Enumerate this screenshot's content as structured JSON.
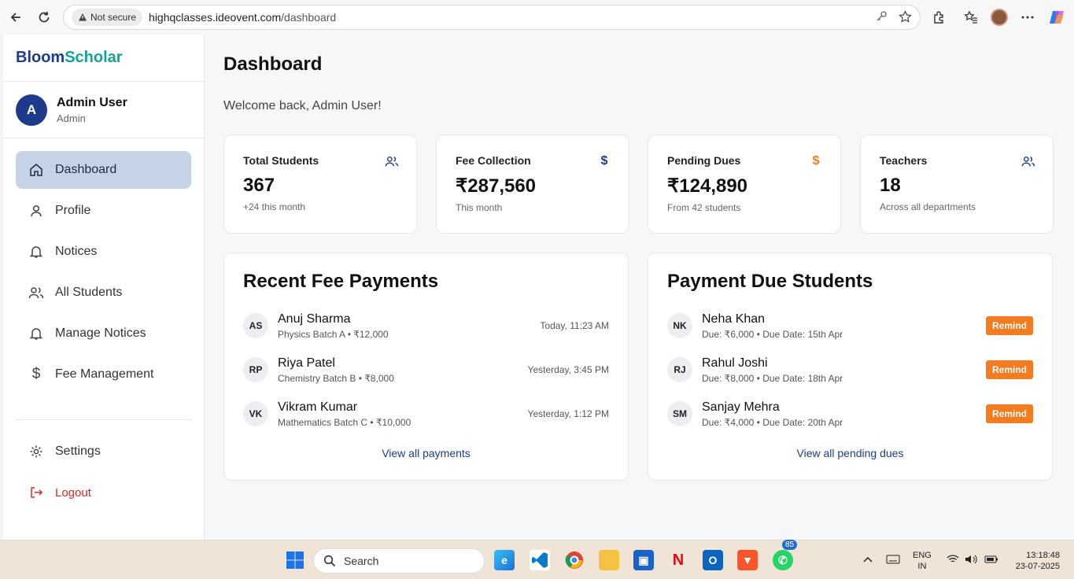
{
  "browser": {
    "security_label": "Not secure",
    "url_host": "highqclasses.ideovent.com",
    "url_path": "/dashboard"
  },
  "brand": {
    "part1": "Bloom",
    "part2": "Scholar",
    "color1": "#1e3a8a",
    "color2": "#14a39a"
  },
  "user": {
    "initial": "A",
    "name": "Admin User",
    "role": "Admin"
  },
  "nav": {
    "items": [
      {
        "label": "Dashboard",
        "icon": "home-icon",
        "active": true
      },
      {
        "label": "Profile",
        "icon": "user-icon"
      },
      {
        "label": "Notices",
        "icon": "bell-icon"
      },
      {
        "label": "All Students",
        "icon": "users-icon"
      },
      {
        "label": "Manage Notices",
        "icon": "bell-icon"
      },
      {
        "label": "Fee Management",
        "icon": "dollar-icon"
      }
    ],
    "settings": "Settings",
    "logout": "Logout"
  },
  "page": {
    "title": "Dashboard",
    "welcome": "Welcome back, Admin User!"
  },
  "stats": [
    {
      "label": "Total Students",
      "value": "367",
      "sub": "+24 this month",
      "icon": "users-icon"
    },
    {
      "label": "Fee Collection",
      "value": "₹287,560",
      "sub": "This month",
      "icon": "dollar-icon"
    },
    {
      "label": "Pending Dues",
      "value": "₹124,890",
      "sub": "From 42 students",
      "icon": "dollar-icon"
    },
    {
      "label": "Teachers",
      "value": "18",
      "sub": "Across all departments",
      "icon": "users-icon"
    }
  ],
  "recent_payments": {
    "title": "Recent Fee Payments",
    "rows": [
      {
        "initials": "AS",
        "name": "Anuj Sharma",
        "sub": "Physics Batch A • ₹12,000",
        "time": "Today, 11:23 AM"
      },
      {
        "initials": "RP",
        "name": "Riya Patel",
        "sub": "Chemistry Batch B • ₹8,000",
        "time": "Yesterday, 3:45 PM"
      },
      {
        "initials": "VK",
        "name": "Vikram Kumar",
        "sub": "Mathematics Batch C • ₹10,000",
        "time": "Yesterday, 1:12 PM"
      }
    ],
    "link": "View all payments"
  },
  "due_students": {
    "title": "Payment Due Students",
    "rows": [
      {
        "initials": "NK",
        "name": "Neha Khan",
        "sub": "Due: ₹6,000 • Due Date: 15th Apr",
        "action": "Remind"
      },
      {
        "initials": "RJ",
        "name": "Rahul Joshi",
        "sub": "Due: ₹8,000 • Due Date: 18th Apr",
        "action": "Remind"
      },
      {
        "initials": "SM",
        "name": "Sanjay Mehra",
        "sub": "Due: ₹4,000 • Due Date: 20th Apr",
        "action": "Remind"
      }
    ],
    "link": "View all pending dues"
  },
  "taskbar": {
    "search_placeholder": "Search",
    "whatsapp_badge": "85",
    "lang": "ENG",
    "region": "IN",
    "time": "13:18:48",
    "date": "23-07-2025"
  },
  "colors": {
    "accent": "#1e3a8a",
    "orange": "#f47b20",
    "active_nav": "#c6d3e6",
    "logout": "#dc2626"
  }
}
